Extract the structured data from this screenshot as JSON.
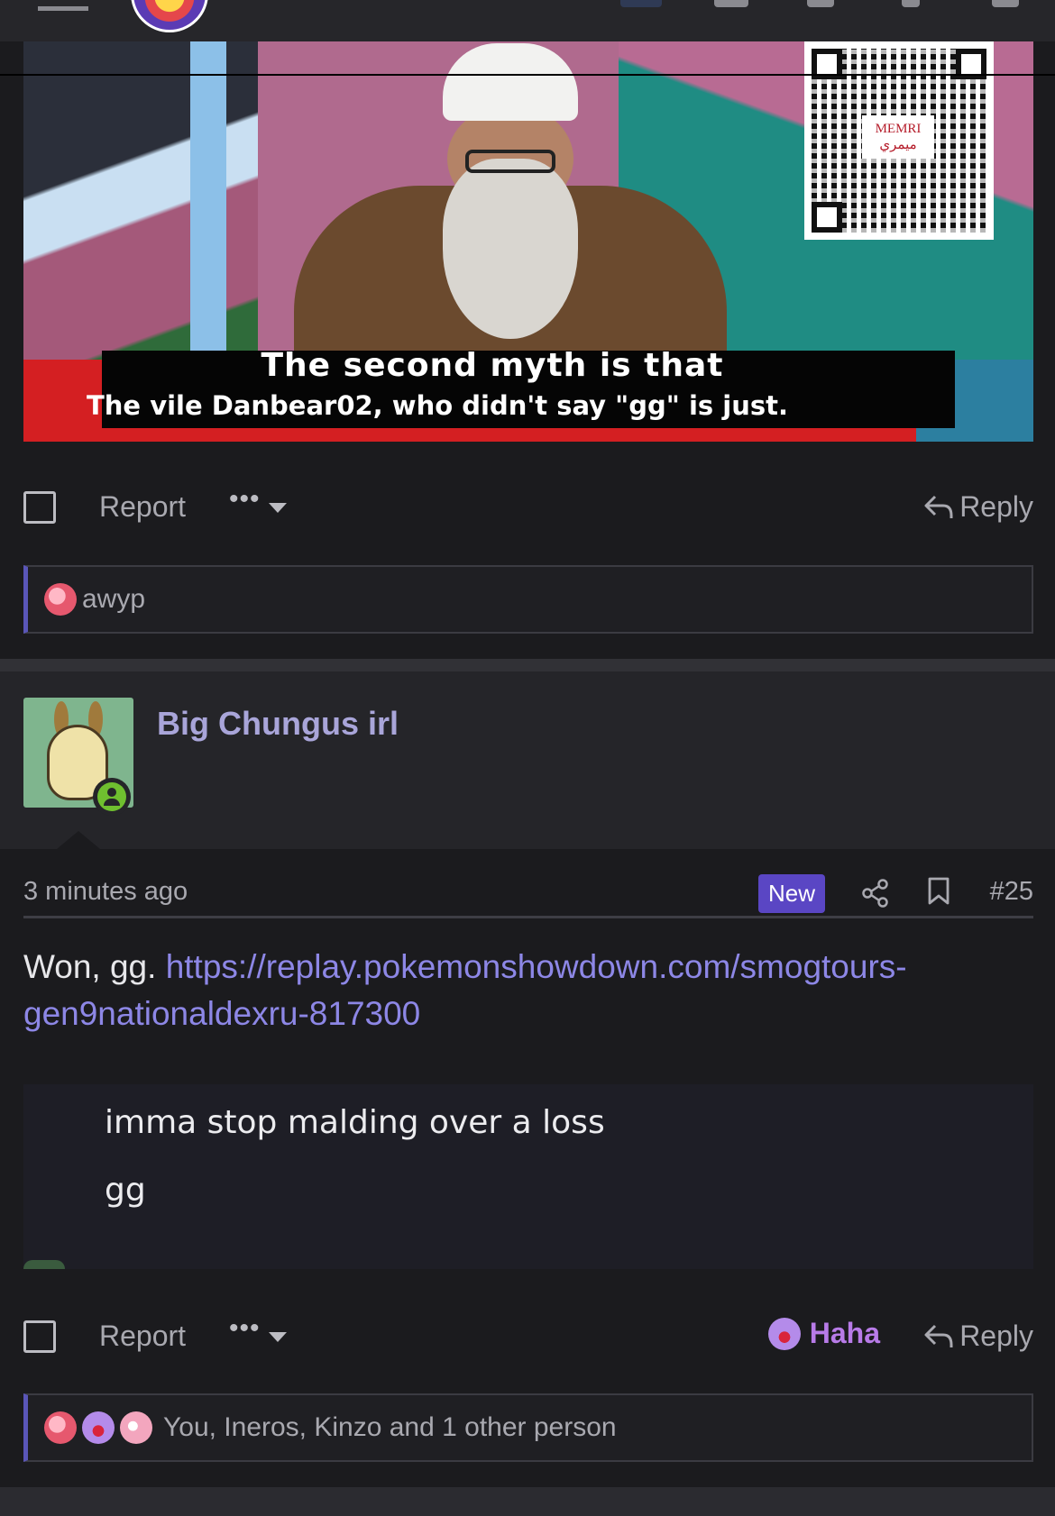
{
  "media": {
    "caption_line1": "The second myth is that",
    "caption_line2": "The vile Danbear02, who didn't say \"gg\" is  just.",
    "qr_label_en": "MEMRI",
    "qr_label_ar": "ميمري"
  },
  "post1": {
    "actions": {
      "report_label": "Report",
      "more_label": "•••",
      "reply_label": "Reply"
    },
    "reactions_text": "awyp"
  },
  "post2": {
    "username": "Big Chungus irl",
    "timestamp": "3 minutes ago",
    "new_badge": "New",
    "post_number": "#25",
    "body_prefix": "Won, gg. ",
    "link_text": "https://replay.pokemonshowdown.com/smogtours-gen9nationaldexru-817300",
    "quote_line1": "imma stop malding over a loss",
    "quote_line2": "gg",
    "actions": {
      "report_label": "Report",
      "more_label": "•••",
      "haha_label": "Haha",
      "reply_label": "Reply"
    },
    "reactions_text": "You, Ineros, Kinzo and 1 other person"
  },
  "colors": {
    "background": "#1b1b1e",
    "accent": "#5a46c4",
    "link": "#8d87e6",
    "username": "#a9a5d9",
    "haha": "#b87be8",
    "online": "#6fbf2f"
  },
  "icons": [
    "menu-icon",
    "site-logo",
    "reply-icon",
    "share-icon",
    "bookmark-icon",
    "online-status-icon",
    "haha-reaction-icon"
  ]
}
